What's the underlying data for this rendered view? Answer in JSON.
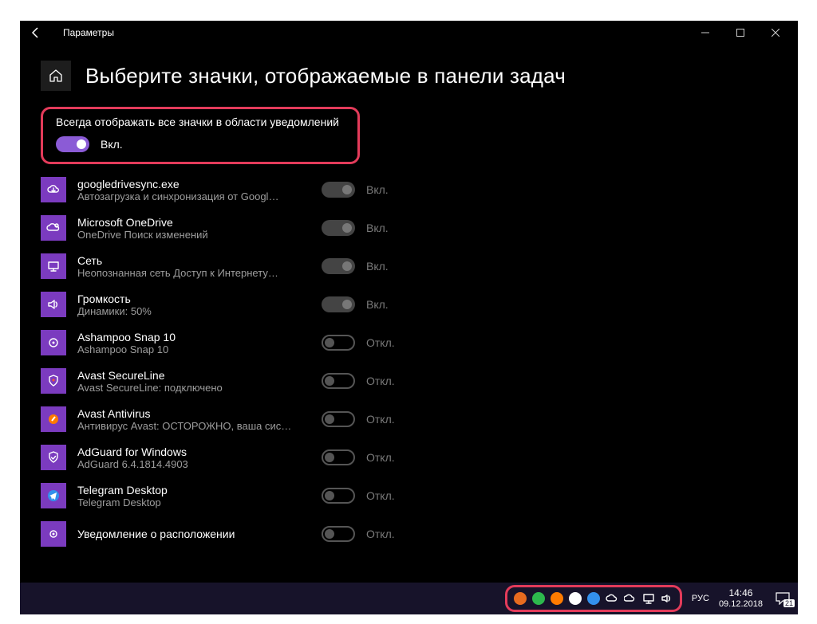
{
  "window": {
    "title": "Параметры"
  },
  "page": {
    "title": "Выберите значки, отображаемые в панели задач"
  },
  "master": {
    "label": "Всегда отображать все значки в области уведомлений",
    "state_text": "Вкл.",
    "on": true
  },
  "state_on_text": "Вкл.",
  "state_off_text": "Откл.",
  "items": [
    {
      "name": "googledrivesync.exe",
      "sub": "Автозагрузка и синхронизация от Googl…",
      "on": true,
      "icon": "cloud"
    },
    {
      "name": "Microsoft OneDrive",
      "sub": "OneDrive Поиск изменений",
      "on": true,
      "icon": "onedrive"
    },
    {
      "name": "Сеть",
      "sub": "Неопознанная сеть Доступ к Интернету…",
      "on": true,
      "icon": "network"
    },
    {
      "name": "Громкость",
      "sub": "Динамики: 50%",
      "on": true,
      "icon": "volume"
    },
    {
      "name": "Ashampoo Snap 10",
      "sub": "Ashampoo Snap 10",
      "on": false,
      "icon": "snap"
    },
    {
      "name": "Avast SecureLine",
      "sub": "Avast SecureLine: подключено",
      "on": false,
      "icon": "secureline"
    },
    {
      "name": "Avast Antivirus",
      "sub": "Антивирус Avast: ОСТОРОЖНО, ваша сис…",
      "on": false,
      "icon": "avast"
    },
    {
      "name": "AdGuard for Windows",
      "sub": "AdGuard 6.4.1814.4903",
      "on": false,
      "icon": "adguard"
    },
    {
      "name": "Telegram Desktop",
      "sub": "Telegram Desktop",
      "on": false,
      "icon": "telegram"
    },
    {
      "name": "Уведомление о расположении",
      "sub": "",
      "on": false,
      "icon": "location"
    }
  ],
  "tray_icons": [
    {
      "name": "snap-icon",
      "color": "#e86b1f"
    },
    {
      "name": "adguard-icon",
      "color": "#2db84d"
    },
    {
      "name": "avast-icon",
      "color": "#ff7b00"
    },
    {
      "name": "secureline-icon",
      "color": "#ffffff"
    },
    {
      "name": "telegram-icon",
      "color": "#3390ec"
    },
    {
      "name": "gdrive-icon",
      "color": "#ffffff"
    },
    {
      "name": "onedrive-icon",
      "color": "#ffffff"
    },
    {
      "name": "network-icon",
      "color": "#ffffff"
    },
    {
      "name": "volume-icon",
      "color": "#ffffff"
    }
  ],
  "taskbar": {
    "lang": "РУС",
    "time": "14:46",
    "date": "09.12.2018",
    "notifications": "21"
  }
}
